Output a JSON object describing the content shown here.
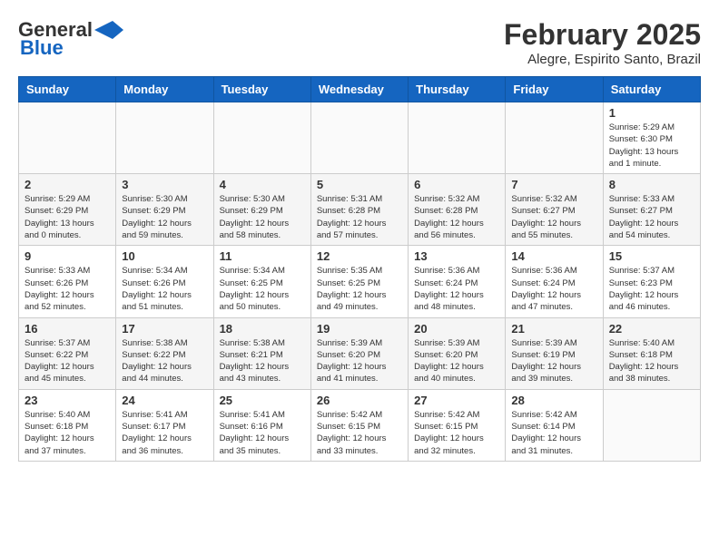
{
  "header": {
    "logo_general": "General",
    "logo_blue": "Blue",
    "month_title": "February 2025",
    "location": "Alegre, Espirito Santo, Brazil"
  },
  "weekdays": [
    "Sunday",
    "Monday",
    "Tuesday",
    "Wednesday",
    "Thursday",
    "Friday",
    "Saturday"
  ],
  "weeks": [
    [
      {
        "day": "",
        "info": ""
      },
      {
        "day": "",
        "info": ""
      },
      {
        "day": "",
        "info": ""
      },
      {
        "day": "",
        "info": ""
      },
      {
        "day": "",
        "info": ""
      },
      {
        "day": "",
        "info": ""
      },
      {
        "day": "1",
        "info": "Sunrise: 5:29 AM\nSunset: 6:30 PM\nDaylight: 13 hours\nand 1 minute."
      }
    ],
    [
      {
        "day": "2",
        "info": "Sunrise: 5:29 AM\nSunset: 6:29 PM\nDaylight: 13 hours\nand 0 minutes."
      },
      {
        "day": "3",
        "info": "Sunrise: 5:30 AM\nSunset: 6:29 PM\nDaylight: 12 hours\nand 59 minutes."
      },
      {
        "day": "4",
        "info": "Sunrise: 5:30 AM\nSunset: 6:29 PM\nDaylight: 12 hours\nand 58 minutes."
      },
      {
        "day": "5",
        "info": "Sunrise: 5:31 AM\nSunset: 6:28 PM\nDaylight: 12 hours\nand 57 minutes."
      },
      {
        "day": "6",
        "info": "Sunrise: 5:32 AM\nSunset: 6:28 PM\nDaylight: 12 hours\nand 56 minutes."
      },
      {
        "day": "7",
        "info": "Sunrise: 5:32 AM\nSunset: 6:27 PM\nDaylight: 12 hours\nand 55 minutes."
      },
      {
        "day": "8",
        "info": "Sunrise: 5:33 AM\nSunset: 6:27 PM\nDaylight: 12 hours\nand 54 minutes."
      }
    ],
    [
      {
        "day": "9",
        "info": "Sunrise: 5:33 AM\nSunset: 6:26 PM\nDaylight: 12 hours\nand 52 minutes."
      },
      {
        "day": "10",
        "info": "Sunrise: 5:34 AM\nSunset: 6:26 PM\nDaylight: 12 hours\nand 51 minutes."
      },
      {
        "day": "11",
        "info": "Sunrise: 5:34 AM\nSunset: 6:25 PM\nDaylight: 12 hours\nand 50 minutes."
      },
      {
        "day": "12",
        "info": "Sunrise: 5:35 AM\nSunset: 6:25 PM\nDaylight: 12 hours\nand 49 minutes."
      },
      {
        "day": "13",
        "info": "Sunrise: 5:36 AM\nSunset: 6:24 PM\nDaylight: 12 hours\nand 48 minutes."
      },
      {
        "day": "14",
        "info": "Sunrise: 5:36 AM\nSunset: 6:24 PM\nDaylight: 12 hours\nand 47 minutes."
      },
      {
        "day": "15",
        "info": "Sunrise: 5:37 AM\nSunset: 6:23 PM\nDaylight: 12 hours\nand 46 minutes."
      }
    ],
    [
      {
        "day": "16",
        "info": "Sunrise: 5:37 AM\nSunset: 6:22 PM\nDaylight: 12 hours\nand 45 minutes."
      },
      {
        "day": "17",
        "info": "Sunrise: 5:38 AM\nSunset: 6:22 PM\nDaylight: 12 hours\nand 44 minutes."
      },
      {
        "day": "18",
        "info": "Sunrise: 5:38 AM\nSunset: 6:21 PM\nDaylight: 12 hours\nand 43 minutes."
      },
      {
        "day": "19",
        "info": "Sunrise: 5:39 AM\nSunset: 6:20 PM\nDaylight: 12 hours\nand 41 minutes."
      },
      {
        "day": "20",
        "info": "Sunrise: 5:39 AM\nSunset: 6:20 PM\nDaylight: 12 hours\nand 40 minutes."
      },
      {
        "day": "21",
        "info": "Sunrise: 5:39 AM\nSunset: 6:19 PM\nDaylight: 12 hours\nand 39 minutes."
      },
      {
        "day": "22",
        "info": "Sunrise: 5:40 AM\nSunset: 6:18 PM\nDaylight: 12 hours\nand 38 minutes."
      }
    ],
    [
      {
        "day": "23",
        "info": "Sunrise: 5:40 AM\nSunset: 6:18 PM\nDaylight: 12 hours\nand 37 minutes."
      },
      {
        "day": "24",
        "info": "Sunrise: 5:41 AM\nSunset: 6:17 PM\nDaylight: 12 hours\nand 36 minutes."
      },
      {
        "day": "25",
        "info": "Sunrise: 5:41 AM\nSunset: 6:16 PM\nDaylight: 12 hours\nand 35 minutes."
      },
      {
        "day": "26",
        "info": "Sunrise: 5:42 AM\nSunset: 6:15 PM\nDaylight: 12 hours\nand 33 minutes."
      },
      {
        "day": "27",
        "info": "Sunrise: 5:42 AM\nSunset: 6:15 PM\nDaylight: 12 hours\nand 32 minutes."
      },
      {
        "day": "28",
        "info": "Sunrise: 5:42 AM\nSunset: 6:14 PM\nDaylight: 12 hours\nand 31 minutes."
      },
      {
        "day": "",
        "info": ""
      }
    ]
  ]
}
